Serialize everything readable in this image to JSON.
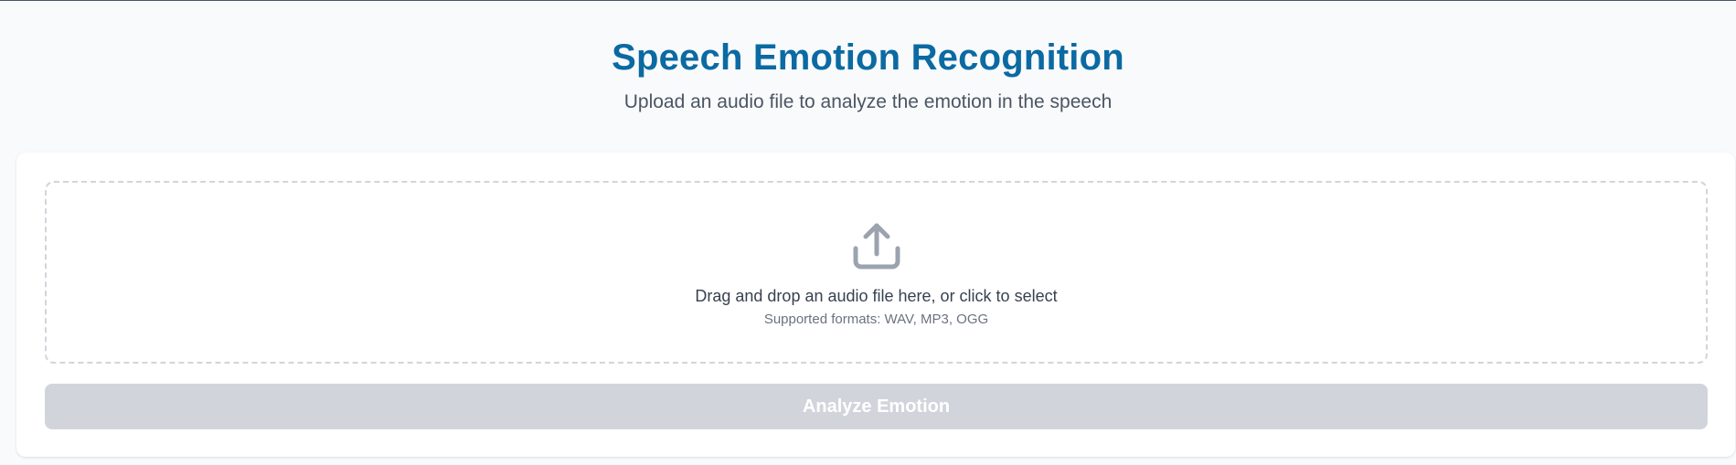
{
  "header": {
    "title": "Speech Emotion Recognition",
    "subtitle": "Upload an audio file to analyze the emotion in the speech"
  },
  "upload": {
    "icon": "upload-icon",
    "prompt": "Drag and drop an audio file here, or click to select",
    "formats": "Supported formats: WAV, MP3, OGG"
  },
  "actions": {
    "analyze_label": "Analyze Emotion",
    "analyze_disabled": true
  },
  "colors": {
    "title": "#0b6aa2",
    "background": "#f8fafc",
    "button_disabled": "#d1d5db",
    "icon": "#9ca3af"
  }
}
